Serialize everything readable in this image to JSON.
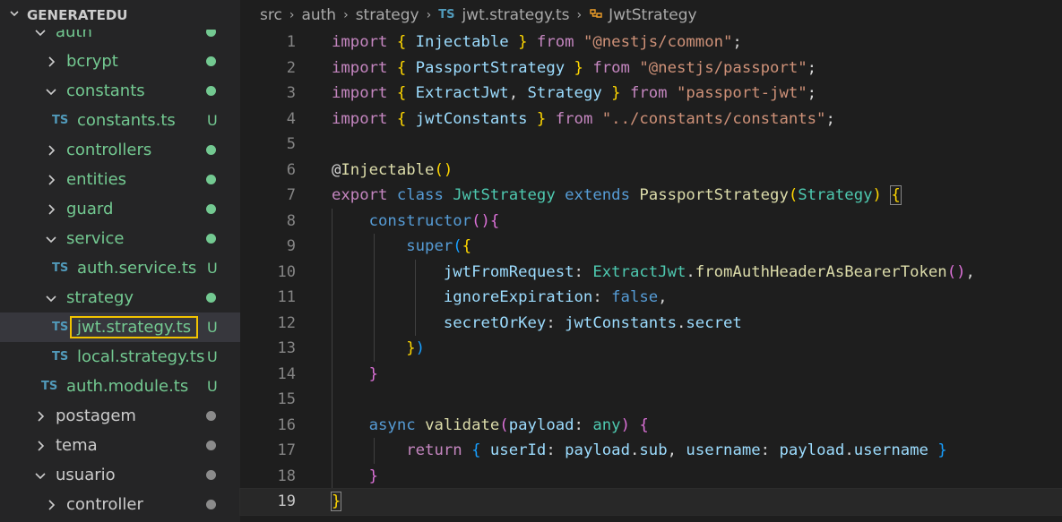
{
  "explorer": {
    "title": "GENERATEDU",
    "items": [
      {
        "label": "auth",
        "type": "folder",
        "open": true,
        "level": 1,
        "color": "green",
        "status": "dot-green"
      },
      {
        "label": "bcrypt",
        "type": "folder",
        "open": false,
        "level": 2,
        "color": "green",
        "status": "dot-green"
      },
      {
        "label": "constants",
        "type": "folder",
        "open": true,
        "level": 2,
        "color": "green",
        "status": "dot-green"
      },
      {
        "label": "constants.ts",
        "type": "file",
        "level": 3,
        "color": "green",
        "status": "U",
        "icon": "TS"
      },
      {
        "label": "controllers",
        "type": "folder",
        "open": false,
        "level": 2,
        "color": "green",
        "status": "dot-green"
      },
      {
        "label": "entities",
        "type": "folder",
        "open": false,
        "level": 2,
        "color": "green",
        "status": "dot-green"
      },
      {
        "label": "guard",
        "type": "folder",
        "open": false,
        "level": 2,
        "color": "green",
        "status": "dot-green"
      },
      {
        "label": "service",
        "type": "folder",
        "open": true,
        "level": 2,
        "color": "green",
        "status": "dot-green"
      },
      {
        "label": "auth.service.ts",
        "type": "file",
        "level": 3,
        "color": "green",
        "status": "U",
        "icon": "TS"
      },
      {
        "label": "strategy",
        "type": "folder",
        "open": true,
        "level": 2,
        "color": "green",
        "status": "dot-green"
      },
      {
        "label": "jwt.strategy.ts",
        "type": "file",
        "level": 3,
        "color": "green",
        "status": "U",
        "icon": "TS",
        "selected": true
      },
      {
        "label": "local.strategy.ts",
        "type": "file",
        "level": 3,
        "color": "green",
        "status": "U",
        "icon": "TS"
      },
      {
        "label": "auth.module.ts",
        "type": "file",
        "level": 2,
        "color": "green",
        "status": "U",
        "icon": "TS"
      },
      {
        "label": "postagem",
        "type": "folder",
        "open": false,
        "level": 1,
        "color": "gray",
        "status": "dot-gray"
      },
      {
        "label": "tema",
        "type": "folder",
        "open": false,
        "level": 1,
        "color": "gray",
        "status": "dot-gray"
      },
      {
        "label": "usuario",
        "type": "folder",
        "open": true,
        "level": 1,
        "color": "gray",
        "status": "dot-gray"
      },
      {
        "label": "controller",
        "type": "folder",
        "open": false,
        "level": 2,
        "color": "gray",
        "status": "dot-gray"
      }
    ]
  },
  "breadcrumbs": {
    "parts": [
      "src",
      "auth",
      "strategy"
    ],
    "file_icon": "TS",
    "file": "jwt.strategy.ts",
    "symbol": "JwtStrategy"
  },
  "editor": {
    "current_line": 19,
    "lines": [
      [
        [
          "import",
          "kw"
        ],
        [
          " ",
          "p"
        ],
        [
          "{",
          "b1"
        ],
        [
          " Injectable ",
          "var"
        ],
        [
          "}",
          "b1"
        ],
        [
          " ",
          "p"
        ],
        [
          "from",
          "kw"
        ],
        [
          " ",
          "p"
        ],
        [
          "\"@nestjs/common\"",
          "str"
        ],
        [
          ";",
          "p"
        ]
      ],
      [
        [
          "import",
          "kw"
        ],
        [
          " ",
          "p"
        ],
        [
          "{",
          "b1"
        ],
        [
          " PassportStrategy ",
          "var"
        ],
        [
          "}",
          "b1"
        ],
        [
          " ",
          "p"
        ],
        [
          "from",
          "kw"
        ],
        [
          " ",
          "p"
        ],
        [
          "\"@nestjs/passport\"",
          "str"
        ],
        [
          ";",
          "p"
        ]
      ],
      [
        [
          "import",
          "kw"
        ],
        [
          " ",
          "p"
        ],
        [
          "{",
          "b1"
        ],
        [
          " ExtractJwt",
          "var"
        ],
        [
          ", ",
          "p"
        ],
        [
          "Strategy ",
          "var"
        ],
        [
          "}",
          "b1"
        ],
        [
          " ",
          "p"
        ],
        [
          "from",
          "kw"
        ],
        [
          " ",
          "p"
        ],
        [
          "\"passport-jwt\"",
          "str"
        ],
        [
          ";",
          "p"
        ]
      ],
      [
        [
          "import",
          "kw"
        ],
        [
          " ",
          "p"
        ],
        [
          "{",
          "b1"
        ],
        [
          " jwtConstants ",
          "var"
        ],
        [
          "}",
          "b1"
        ],
        [
          " ",
          "p"
        ],
        [
          "from",
          "kw"
        ],
        [
          " ",
          "p"
        ],
        [
          "\"../constants/constants\"",
          "str"
        ],
        [
          ";",
          "p"
        ]
      ],
      [],
      [
        [
          "@",
          "p"
        ],
        [
          "Injectable",
          "fn"
        ],
        [
          "()",
          "b1"
        ]
      ],
      [
        [
          "export",
          "kw"
        ],
        [
          " ",
          "p"
        ],
        [
          "class",
          "dkw"
        ],
        [
          " ",
          "p"
        ],
        [
          "JwtStrategy",
          "cls"
        ],
        [
          " ",
          "p"
        ],
        [
          "extends",
          "dkw"
        ],
        [
          " ",
          "p"
        ],
        [
          "PassportStrategy",
          "fn"
        ],
        [
          "(",
          "b1"
        ],
        [
          "Strategy",
          "cls"
        ],
        [
          ")",
          "b1"
        ],
        [
          " ",
          "p"
        ],
        [
          "{",
          "b1m"
        ]
      ],
      [
        [
          "    ",
          "p"
        ],
        [
          "constructor",
          "dkw"
        ],
        [
          "()",
          "b2"
        ],
        [
          "{",
          "b2"
        ]
      ],
      [
        [
          "        ",
          "p"
        ],
        [
          "super",
          "dkw"
        ],
        [
          "(",
          "b3"
        ],
        [
          "{",
          "b1"
        ]
      ],
      [
        [
          "            ",
          "p"
        ],
        [
          "jwtFromRequest",
          "var"
        ],
        [
          ": ",
          "p"
        ],
        [
          "ExtractJwt",
          "cls"
        ],
        [
          ".",
          "p"
        ],
        [
          "fromAuthHeaderAsBearerToken",
          "fn"
        ],
        [
          "()",
          "b2"
        ],
        [
          ",",
          "p"
        ]
      ],
      [
        [
          "            ",
          "p"
        ],
        [
          "ignoreExpiration",
          "var"
        ],
        [
          ": ",
          "p"
        ],
        [
          "false",
          "dkw"
        ],
        [
          ",",
          "p"
        ]
      ],
      [
        [
          "            ",
          "p"
        ],
        [
          "secretOrKey",
          "var"
        ],
        [
          ": ",
          "p"
        ],
        [
          "jwtConstants",
          "var"
        ],
        [
          ".",
          "p"
        ],
        [
          "secret",
          "var"
        ]
      ],
      [
        [
          "        ",
          "p"
        ],
        [
          "}",
          "b1"
        ],
        [
          ")",
          "b3"
        ]
      ],
      [
        [
          "    ",
          "p"
        ],
        [
          "}",
          "b2"
        ]
      ],
      [],
      [
        [
          "    ",
          "p"
        ],
        [
          "async",
          "dkw"
        ],
        [
          " ",
          "p"
        ],
        [
          "validate",
          "fn"
        ],
        [
          "(",
          "b2"
        ],
        [
          "payload",
          "var"
        ],
        [
          ": ",
          "p"
        ],
        [
          "any",
          "cls"
        ],
        [
          ")",
          "b2"
        ],
        [
          " ",
          "p"
        ],
        [
          "{",
          "b2"
        ]
      ],
      [
        [
          "        ",
          "p"
        ],
        [
          "return",
          "kw"
        ],
        [
          " ",
          "p"
        ],
        [
          "{",
          "b3"
        ],
        [
          " userId",
          "var"
        ],
        [
          ": ",
          "p"
        ],
        [
          "payload",
          "var"
        ],
        [
          ".",
          "p"
        ],
        [
          "sub",
          "var"
        ],
        [
          ", ",
          "p"
        ],
        [
          "username",
          "var"
        ],
        [
          ": ",
          "p"
        ],
        [
          "payload",
          "var"
        ],
        [
          ".",
          "p"
        ],
        [
          "username",
          "var"
        ],
        [
          " ",
          "p"
        ],
        [
          "}",
          "b3"
        ]
      ],
      [
        [
          "    ",
          "p"
        ],
        [
          "}",
          "b2"
        ]
      ],
      [
        [
          "}",
          "b1m"
        ]
      ]
    ]
  },
  "colors": {
    "green": "#73c991",
    "gray_dot": "#8b8b8b",
    "selection_outline": "#f2c300"
  }
}
